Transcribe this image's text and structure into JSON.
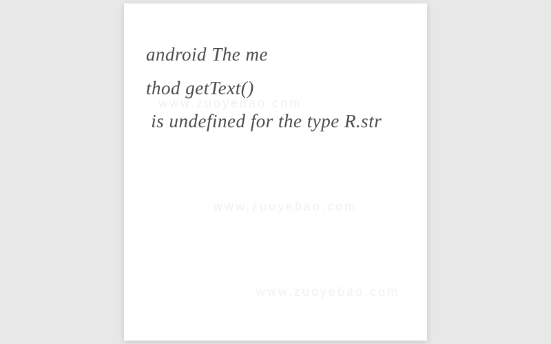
{
  "lines": {
    "l1": "android The me",
    "l2": "thod getText()",
    "l3": " is undefined for the type R.str"
  },
  "watermark": "www.zuoyebao.com"
}
